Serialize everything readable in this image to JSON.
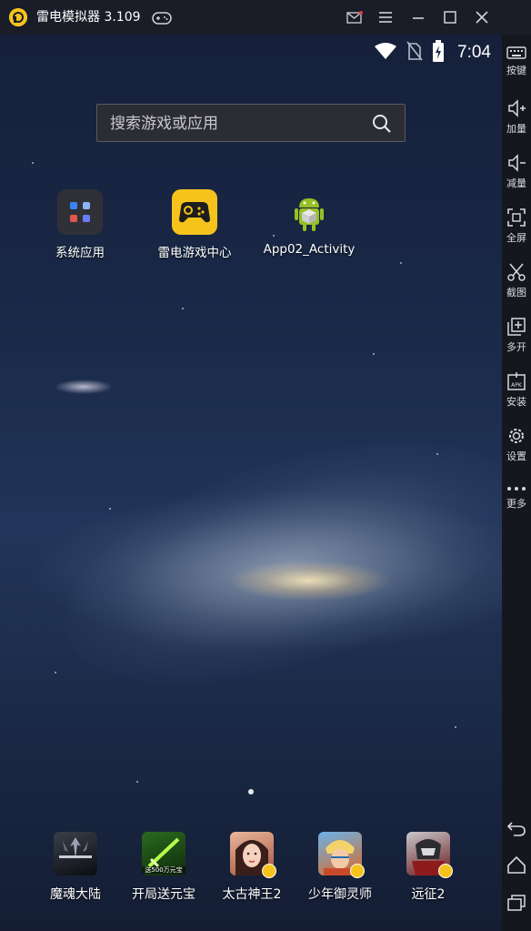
{
  "window": {
    "title": "雷电模拟器 3.109"
  },
  "statusbar": {
    "time": "7:04"
  },
  "search": {
    "placeholder": "搜索游戏或应用"
  },
  "desktop_apps": [
    {
      "label": "系统应用",
      "icon": "folder-icon"
    },
    {
      "label": "雷电游戏中心",
      "icon": "gamepad-icon"
    },
    {
      "label": "App02_Activity",
      "icon": "android-icon"
    }
  ],
  "dock_apps": [
    {
      "label": "魔魂大陆",
      "icon": "game-darkness-icon"
    },
    {
      "label": "开局送元宝",
      "icon": "game-sword-icon",
      "icon_text": "送500万元宝"
    },
    {
      "label": "太古神王2",
      "icon": "game-portrait-icon"
    },
    {
      "label": "少年御灵师",
      "icon": "game-hero-icon"
    },
    {
      "label": "远征2",
      "icon": "game-warrior-icon"
    }
  ],
  "sidebar": {
    "items": [
      {
        "label": "按键",
        "icon": "keyboard-icon"
      },
      {
        "label": "加量",
        "icon": "volume-up-icon"
      },
      {
        "label": "减量",
        "icon": "volume-down-icon"
      },
      {
        "label": "全屏",
        "icon": "fullscreen-icon"
      },
      {
        "label": "截图",
        "icon": "scissors-icon"
      },
      {
        "label": "多开",
        "icon": "multi-instance-icon"
      },
      {
        "label": "安装",
        "icon": "apk-install-icon"
      },
      {
        "label": "设置",
        "icon": "gear-icon"
      },
      {
        "label": "更多",
        "icon": "more-icon"
      }
    ]
  },
  "colors": {
    "accent": "#f5c31c",
    "titlebar": "#1a1d28",
    "sidebar": "#15171f"
  }
}
